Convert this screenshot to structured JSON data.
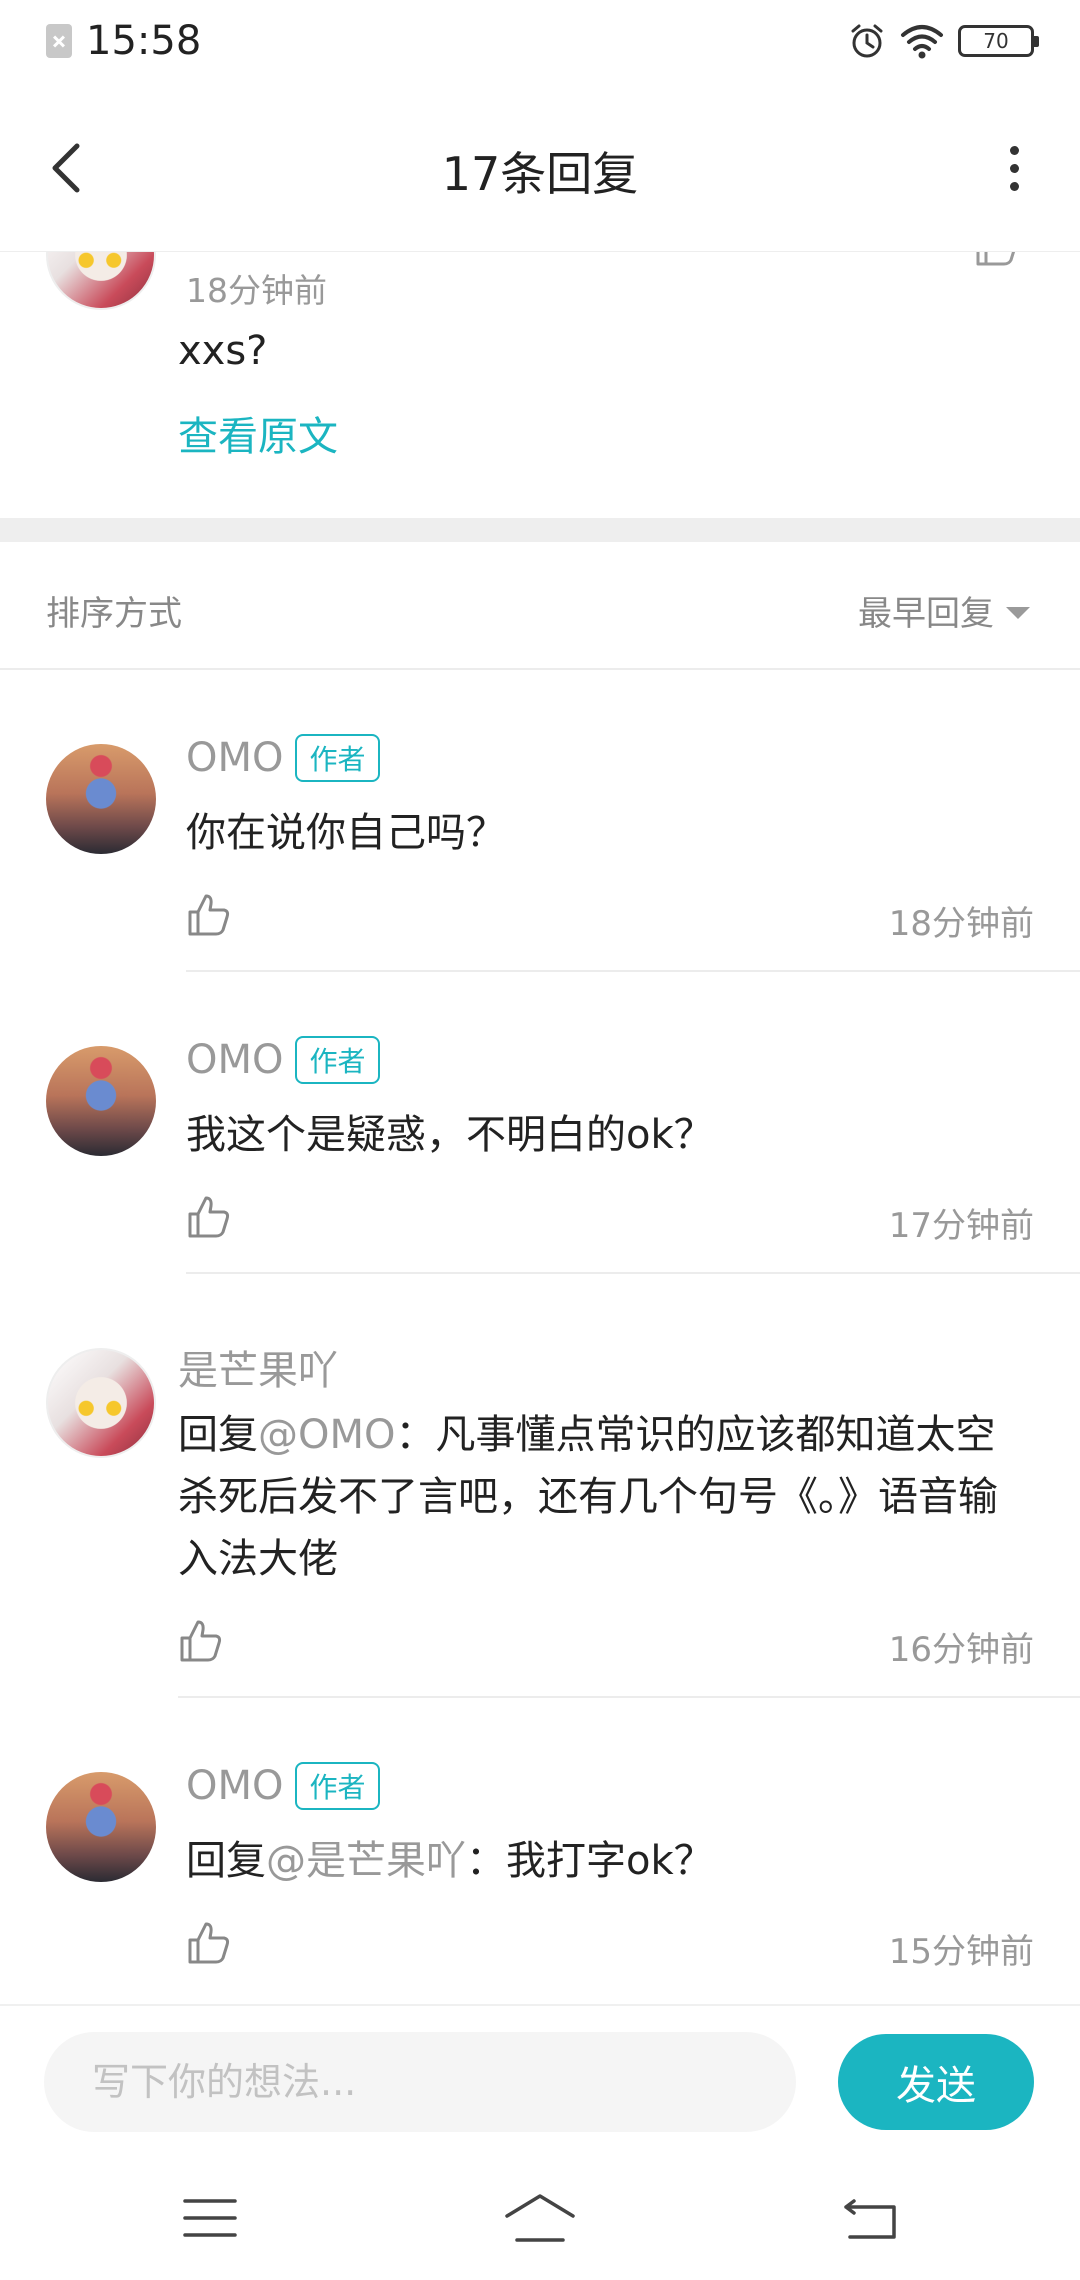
{
  "status_bar": {
    "time": "15:58",
    "battery": "70",
    "icons": [
      "sim-off-icon",
      "alarm-icon",
      "wifi-icon",
      "battery-icon"
    ]
  },
  "header": {
    "title": "17条回复",
    "back_icon": "chevron-left-icon",
    "more_icon": "more-vertical-icon"
  },
  "original_post": {
    "time": "18分钟前",
    "text": "xxs?",
    "view_original": "查看原文"
  },
  "sort": {
    "label": "排序方式",
    "value": "最早回复"
  },
  "replies": [
    {
      "user": "OMO",
      "badge": "作者",
      "text": "你在说你自己吗？",
      "time": "18分钟前"
    },
    {
      "user": "OMO",
      "badge": "作者",
      "text": "我这个是疑惑，不明白的ok？",
      "time": "17分钟前"
    },
    {
      "user": "是芒果吖",
      "prefix": "回复",
      "mention": "@OMO",
      "text": "：凡事懂点常识的应该都知道太空杀死后发不了言吧，还有几个句号《。》语音输入法大佬",
      "time": "16分钟前"
    },
    {
      "user": "OMO",
      "badge": "作者",
      "prefix": "回复",
      "mention": "@是芒果吖",
      "text": "：我打字ok？",
      "time": "15分钟前"
    }
  ],
  "composer": {
    "placeholder": "写下你的想法...",
    "send_label": "发送"
  },
  "system_nav": {
    "icons": [
      "menu-icon",
      "home-icon",
      "back-icon"
    ]
  },
  "colors": {
    "accent": "#1bb5c1",
    "muted_text": "#999999",
    "divider": "#ececec"
  }
}
